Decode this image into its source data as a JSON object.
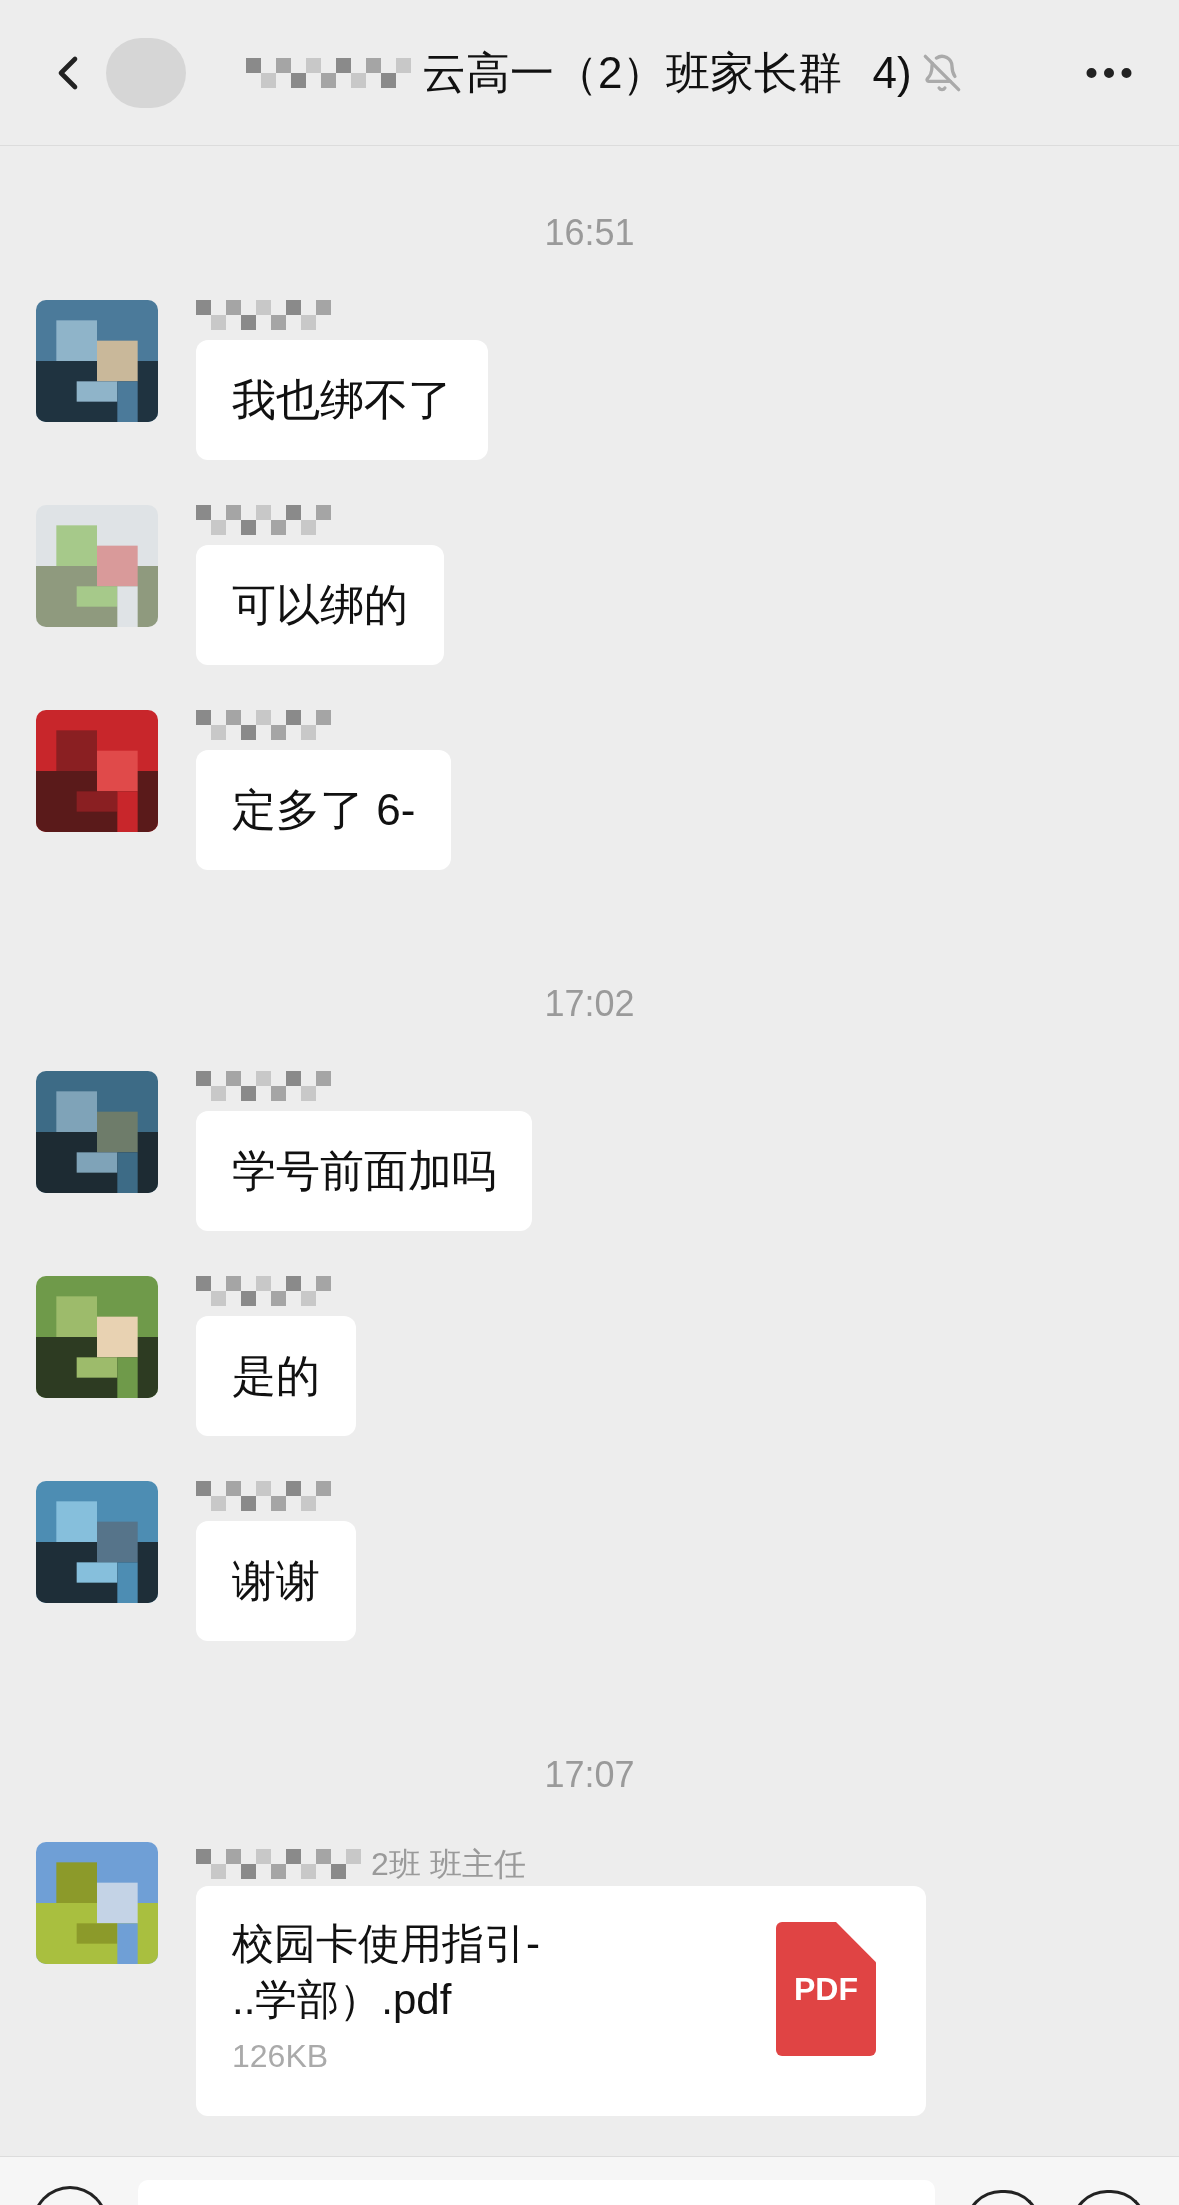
{
  "header": {
    "title": "云高一（2）班家长群",
    "member_count": "4)",
    "muted": true
  },
  "items": [
    {
      "kind": "time",
      "text": "16:51"
    },
    {
      "kind": "message",
      "text": "我也绑不了"
    },
    {
      "kind": "message",
      "text": "可以绑的"
    },
    {
      "kind": "message",
      "text": "定多了 6-"
    },
    {
      "kind": "time",
      "text": "17:02"
    },
    {
      "kind": "message",
      "text": "学号前面加吗"
    },
    {
      "kind": "message",
      "text": "是的"
    },
    {
      "kind": "message",
      "text": "谢谢"
    },
    {
      "kind": "time",
      "text": "17:07"
    },
    {
      "kind": "file",
      "name": "2班 班主任",
      "file_line_1": "校园卡使用指引-",
      "file_line_2": "..学部）.pdf",
      "size": "126KB",
      "badge": "PDF"
    }
  ]
}
